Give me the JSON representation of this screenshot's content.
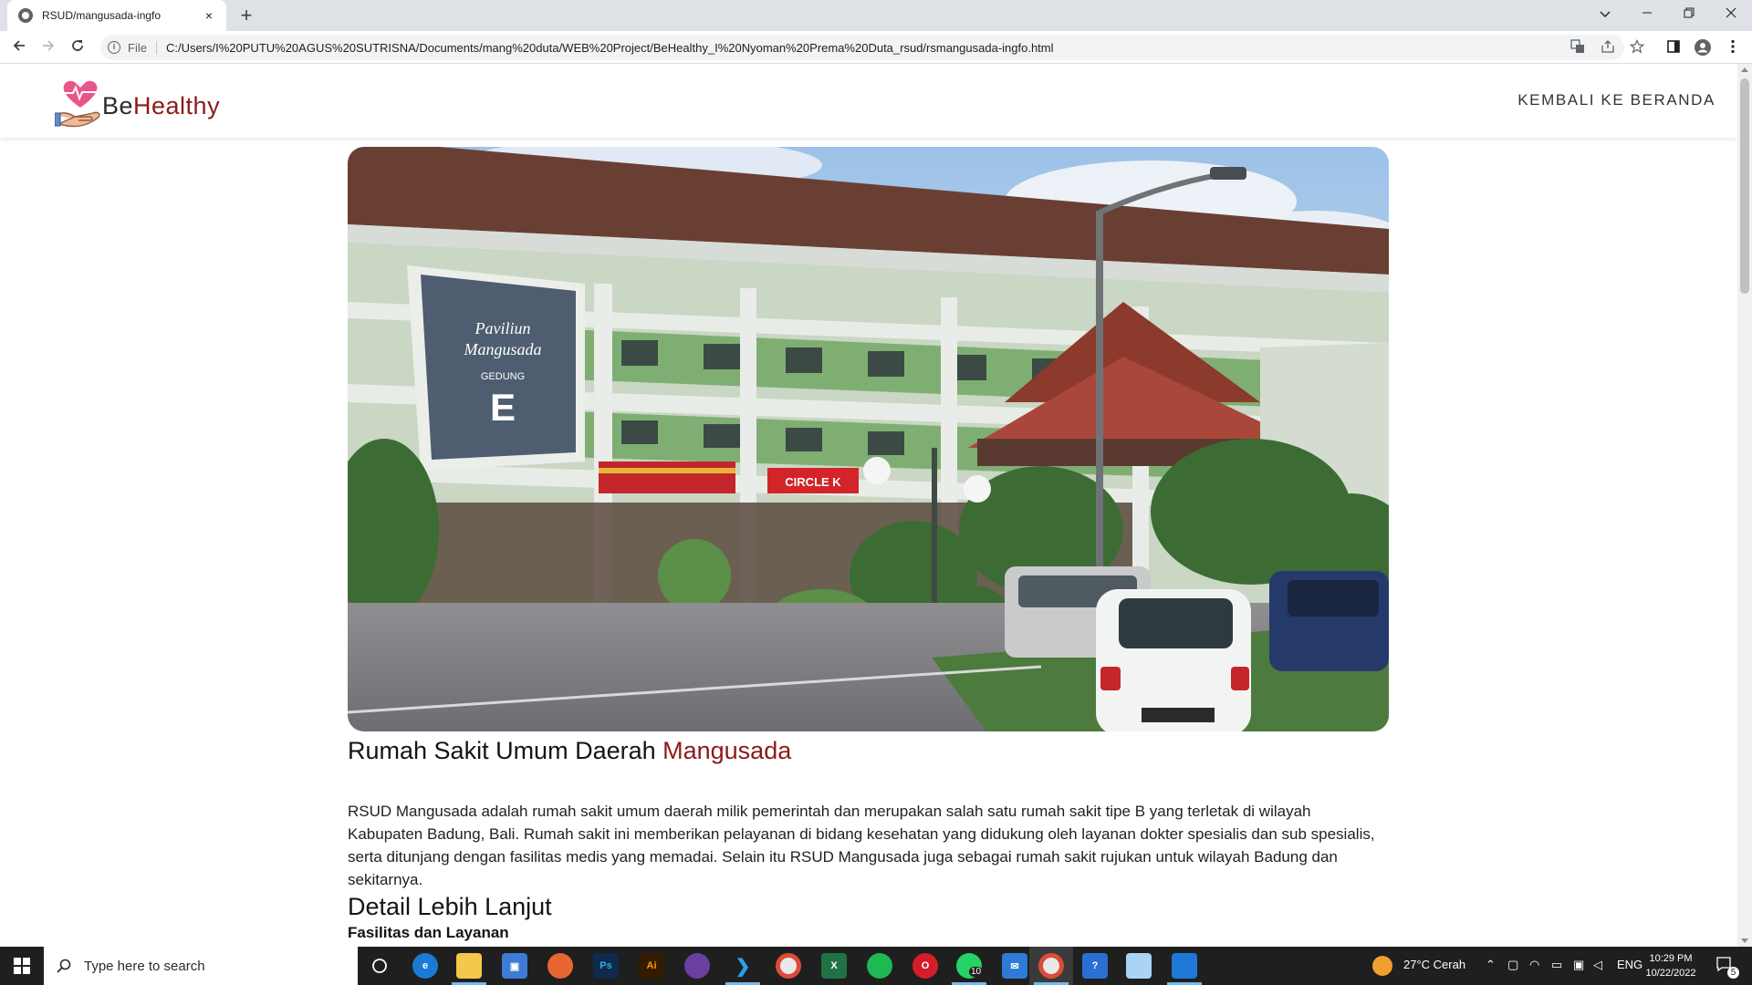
{
  "browser": {
    "tab_title": "RSUD/mangusada-ingfo",
    "tab_close": "×",
    "new_tab": "+",
    "file_label": "File",
    "url": "C:/Users/I%20PUTU%20AGUS%20SUTRISNA/Documents/mang%20duta/WEB%20Project/BeHealthy_I%20Nyoman%20Prema%20Duta_rsud/rsmangusada-ingfo.html"
  },
  "site": {
    "logo_be": "Be",
    "logo_healthy": "Healthy",
    "back_link": "Kembali ke Beranda"
  },
  "content": {
    "title_main": "Rumah Sakit Umum Daerah ",
    "title_accent": "Mangusada",
    "description": "RSUD Mangusada adalah rumah sakit umum daerah milik pemerintah dan merupakan salah satu rumah sakit tipe B yang terletak di wilayah Kabupaten Badung, Bali. Rumah sakit ini memberikan pelayanan di bidang kesehatan yang didukung oleh layanan dokter spesialis dan sub spesialis, serta ditunjang dengan fasilitas medis yang memadai. Selain itu RSUD Mangusada juga sebagai rumah sakit rujukan untuk wilayah Badung dan sekitarnya.",
    "detail_heading": "Detail Lebih Lanjut",
    "sub_heading": "Fasilitas dan Layanan"
  },
  "hero_image": {
    "sign_line1": "Paviliun",
    "sign_line2": "Mangusada",
    "sign_line3": "GEDUNG",
    "sign_letter": "E",
    "store_sign": "CIRCLE K"
  },
  "taskbar": {
    "search_placeholder": "Type here to search",
    "whatsapp_badge": "10",
    "weather": "27°C  Cerah",
    "language": "ENG",
    "time": "10:29 PM",
    "date": "10/22/2022",
    "notification_count": "5"
  },
  "colors": {
    "accent": "#8b1a1a",
    "chrome_bg": "#dee1e6",
    "taskbar_bg": "#1f1f1f"
  }
}
